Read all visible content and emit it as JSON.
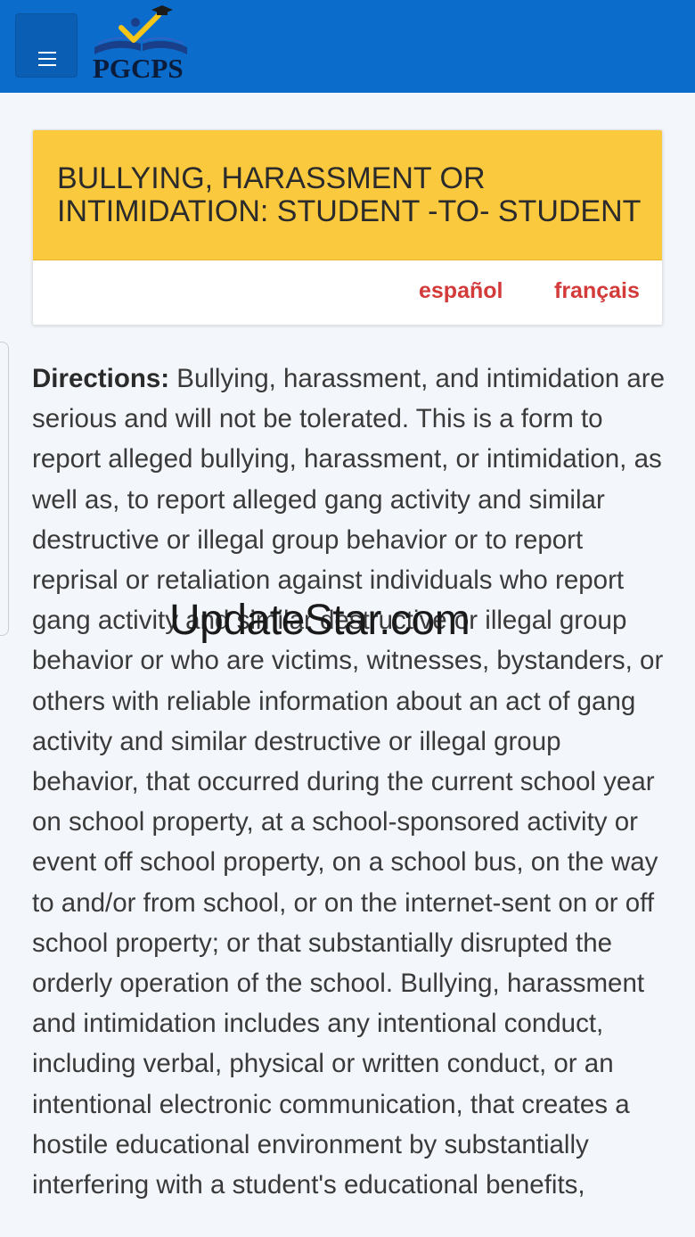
{
  "header": {
    "menu_label": "Menu",
    "logo_text": "PGCPS"
  },
  "card": {
    "title_line1": "BULLYING, HARASSMENT OR",
    "title_line2": "INTIMIDATION: STUDENT -TO- STUDENT",
    "languages": [
      "español",
      "français"
    ]
  },
  "directions": {
    "label": "Directions:",
    "text": " Bullying, harassment, and intimidation are serious and will not be tolerated. This is a form to report alleged bullying, harassment, or intimidation, as well as, to report alleged gang activity and similar destructive or illegal group behavior or to report reprisal or retaliation against individuals who report gang activity and similar destructive or illegal group behavior or who are victims, witnesses, bystanders, or others with reliable information about an act of gang activity and similar destructive or illegal group behavior, that occurred during the current school year on school property, at a school-sponsored activity or event off school property, on a school bus, on the way to and/or from school, or on the internet-sent on or off school property; or that substantially disrupted the orderly operation of the school. Bullying, harassment and intimidation includes any intentional conduct, including verbal, physical or written conduct, or an intentional electronic communication, that creates a hostile educational environment by substantially interfering with a student's educational benefits,"
  },
  "watermark": "UpdateStar.com",
  "colors": {
    "topbar": "#0b6ccc",
    "header_yellow": "#fbc93d",
    "link_red": "#d33a3a"
  }
}
